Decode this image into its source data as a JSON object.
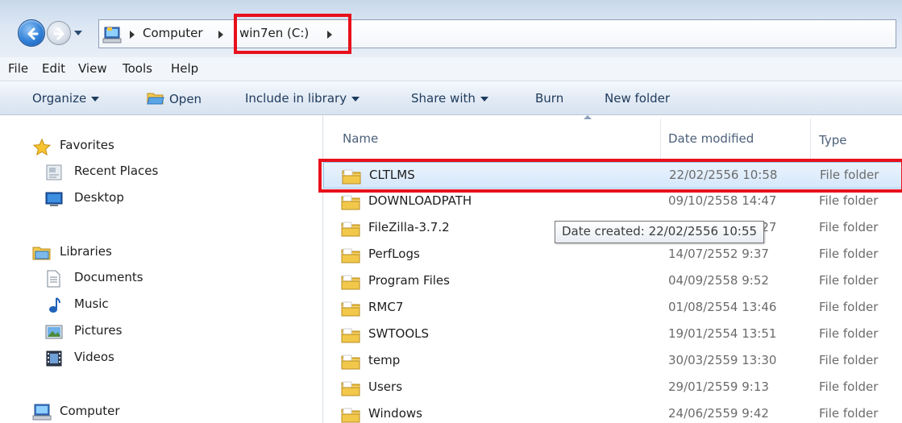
{
  "address": {
    "segments": [
      "Computer",
      "win7en (C:)"
    ]
  },
  "menu": [
    "File",
    "Edit",
    "View",
    "Tools",
    "Help"
  ],
  "toolbar": {
    "organize": "Organize",
    "open": "Open",
    "include_in_library": "Include in library",
    "share_with": "Share with",
    "burn": "Burn",
    "new_folder": "New folder"
  },
  "nav": {
    "favorites": "Favorites",
    "recent_places": "Recent Places",
    "desktop": "Desktop",
    "libraries": "Libraries",
    "documents": "Documents",
    "music": "Music",
    "pictures": "Pictures",
    "videos": "Videos",
    "computer": "Computer"
  },
  "columns": {
    "name": "Name",
    "date_modified": "Date modified",
    "type": "Type"
  },
  "files": [
    {
      "name": "CLTLMS",
      "date": "22/02/2556 10:58",
      "type": "File folder",
      "selected": true
    },
    {
      "name": "DOWNLOADPATH",
      "date": "09/10/2558 14:47",
      "type": "File folder"
    },
    {
      "name": "FileZilla-3.7.2",
      "date": "02/01/2557 16:27",
      "type": "File folder"
    },
    {
      "name": "PerfLogs",
      "date": "14/07/2552 9:37",
      "type": "File folder"
    },
    {
      "name": "Program Files",
      "date": "04/09/2558 9:52",
      "type": "File folder"
    },
    {
      "name": "RMC7",
      "date": "01/08/2554 13:46",
      "type": "File folder"
    },
    {
      "name": "SWTOOLS",
      "date": "19/01/2554 13:51",
      "type": "File folder"
    },
    {
      "name": "temp",
      "date": "30/03/2559 13:30",
      "type": "File folder"
    },
    {
      "name": "Users",
      "date": "29/01/2559 9:13",
      "type": "File folder"
    },
    {
      "name": "Windows",
      "date": "24/06/2559 9:42",
      "type": "File folder"
    }
  ],
  "tooltip": "Date created: 22/02/2556 10:55",
  "colors": {
    "highlight_box": "#e8101c",
    "selection_border": "#9cc7ef"
  }
}
